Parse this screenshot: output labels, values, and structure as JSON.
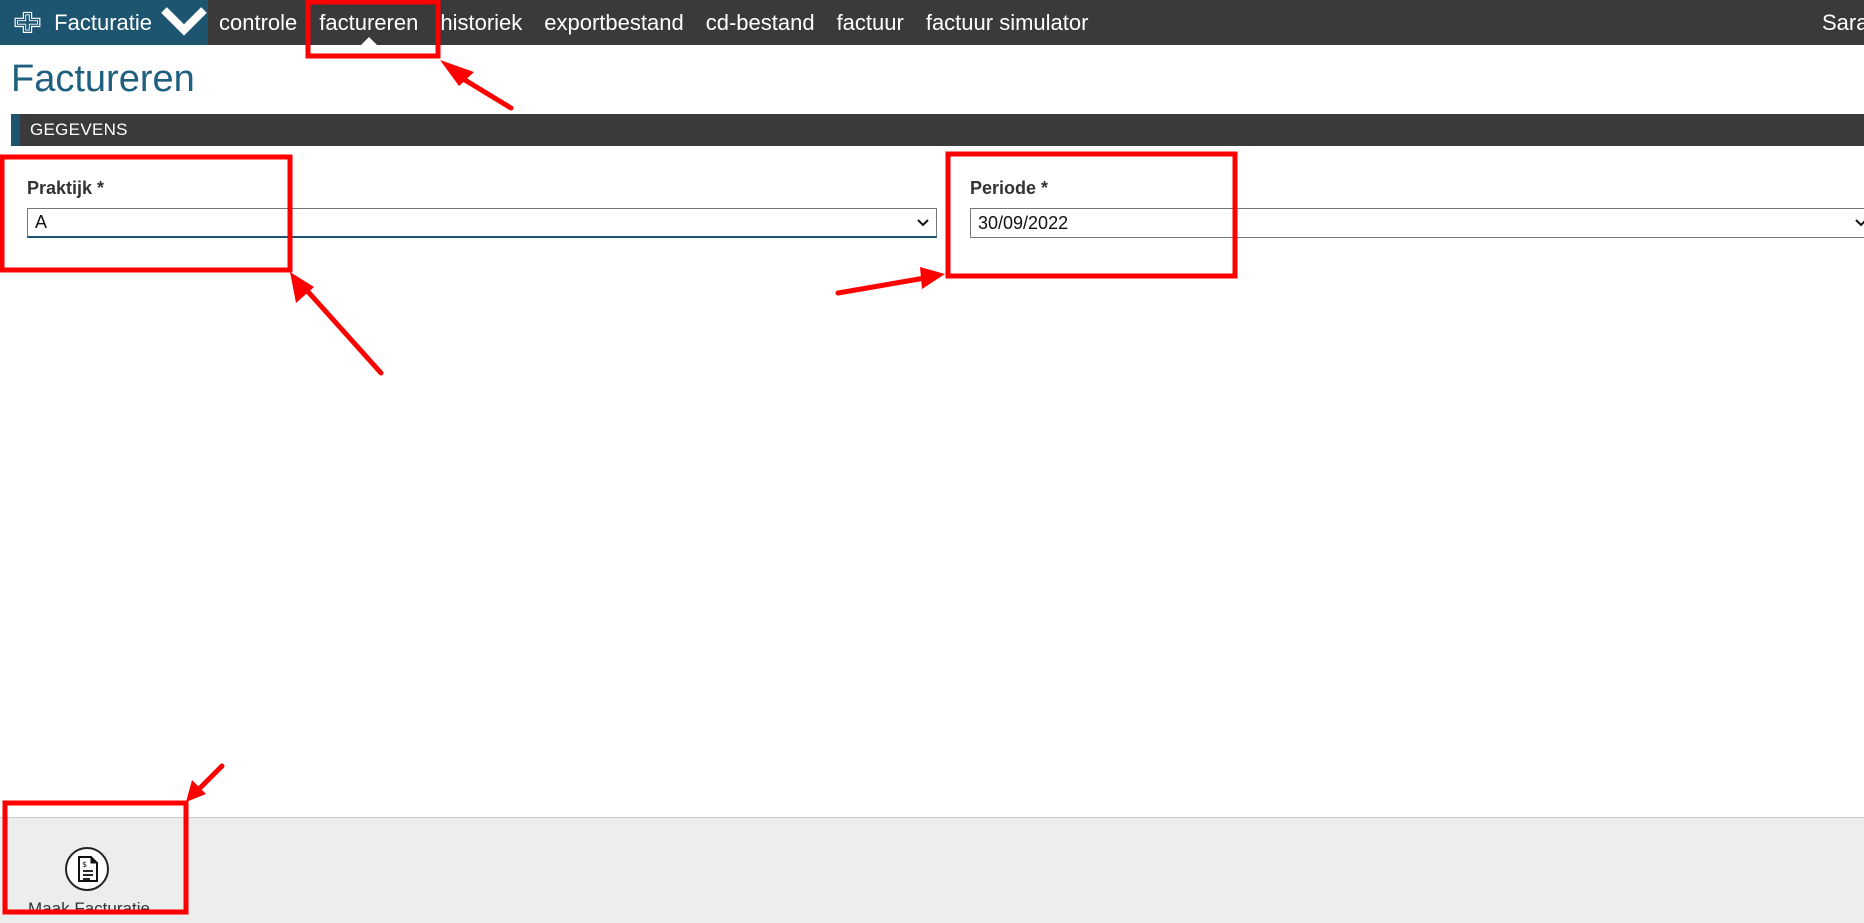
{
  "app": {
    "menu_label": "Facturatie",
    "user_label": "Sara"
  },
  "nav": {
    "items": [
      {
        "label": "controle"
      },
      {
        "label": "factureren",
        "active": true
      },
      {
        "label": "historiek"
      },
      {
        "label": "exportbestand"
      },
      {
        "label": "cd-bestand"
      },
      {
        "label": "factuur"
      },
      {
        "label": "factuur simulator"
      }
    ]
  },
  "page": {
    "title": "Factureren"
  },
  "section": {
    "title": "GEGEVENS"
  },
  "form": {
    "praktijk": {
      "label": "Praktijk *",
      "value": "A"
    },
    "periode": {
      "label": "Periode *",
      "value": "30/09/2022"
    }
  },
  "footer": {
    "button_label": "Maak Facturatie",
    "button_icon": "invoice-dollar-icon"
  },
  "colors": {
    "brand": "#1d5470",
    "topbar": "#3a3a3a",
    "title": "#1f5f7f",
    "annotation": "#ff0000"
  }
}
